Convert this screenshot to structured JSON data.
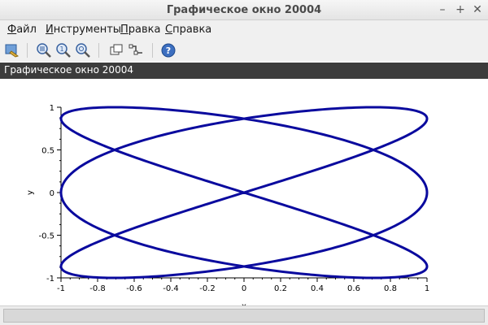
{
  "window": {
    "title": "Графическое окно 20004",
    "controls": {
      "minimize": "–",
      "maximize": "+",
      "close": "✕"
    }
  },
  "menubar": {
    "items": [
      {
        "label": "Файл"
      },
      {
        "label": "Инструменты"
      },
      {
        "label": "Правка"
      },
      {
        "label": "Справка"
      }
    ]
  },
  "toolbar": {
    "buttons": [
      {
        "icon": "figure-settings-icon"
      },
      {
        "icon": "zoom-area-icon"
      },
      {
        "icon": "zoom-reset-icon"
      },
      {
        "icon": "zoom-magnify-icon"
      },
      {
        "icon": "rotate-3d-icon"
      },
      {
        "icon": "datatip-icon"
      },
      {
        "icon": "help-icon"
      }
    ]
  },
  "figure": {
    "label": "Графическое окно 20004"
  },
  "chart_data": {
    "type": "line",
    "title": "",
    "xlabel": "x",
    "ylabel": "y",
    "xlim": [
      -1,
      1
    ],
    "ylim": [
      -1,
      1
    ],
    "xticks": [
      -1,
      -0.8,
      -0.6,
      -0.4,
      -0.2,
      0,
      0.2,
      0.4,
      0.6,
      0.8,
      1
    ],
    "yticks": [
      -1,
      -0.5,
      0,
      0.5,
      1
    ],
    "xtick_labels": [
      "-1",
      "-0.8",
      "-0.6",
      "-0.4",
      "-0.2",
      "0",
      "0.2",
      "0.4",
      "0.6",
      "0.8",
      "1"
    ],
    "ytick_labels": [
      "-1",
      "-0.5",
      "0",
      "0.5",
      "1"
    ],
    "series": [
      {
        "equation": "x = sin(3t), y = sin(2t)",
        "color": "#0a0a9e"
      }
    ],
    "grid": false
  },
  "statusbar": {
    "text": ""
  }
}
